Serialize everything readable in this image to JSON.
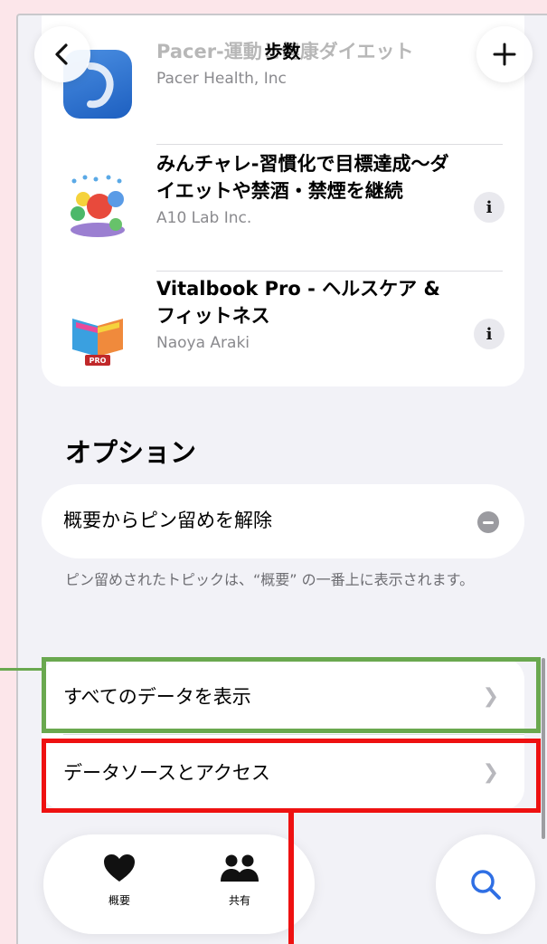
{
  "nav": {
    "title": "歩数",
    "back_icon": "chevron-left-icon",
    "add_icon": "plus-icon"
  },
  "apps": [
    {
      "name": "Pacer-運動と健康ダイエット",
      "developer": "Pacer Health, Inc"
    },
    {
      "name": "みんチャレ-習慣化で目標達成〜ダイエットや禁酒・禁煙を継続",
      "developer": "A10 Lab Inc.",
      "info": "i"
    },
    {
      "name": "Vitalbook Pro - ヘルスケア & フィットネス",
      "developer": "Naoya Araki",
      "info": "i"
    }
  ],
  "options": {
    "title": "オプション",
    "unpin_label": "概要からピン留めを解除",
    "footnote": "ピン留めされたトピックは、“概要” の一番上に表示されます。"
  },
  "data_rows": [
    {
      "label": "すべてのデータを表示"
    },
    {
      "label": "データソースとアクセス"
    }
  ],
  "tabbar": {
    "summary": "概要",
    "share": "共有"
  },
  "colors": {
    "highlight_green": "#6aa84f",
    "highlight_red": "#ee1111",
    "background": "#fce6ea",
    "accent_blue": "#2f6fe4"
  }
}
